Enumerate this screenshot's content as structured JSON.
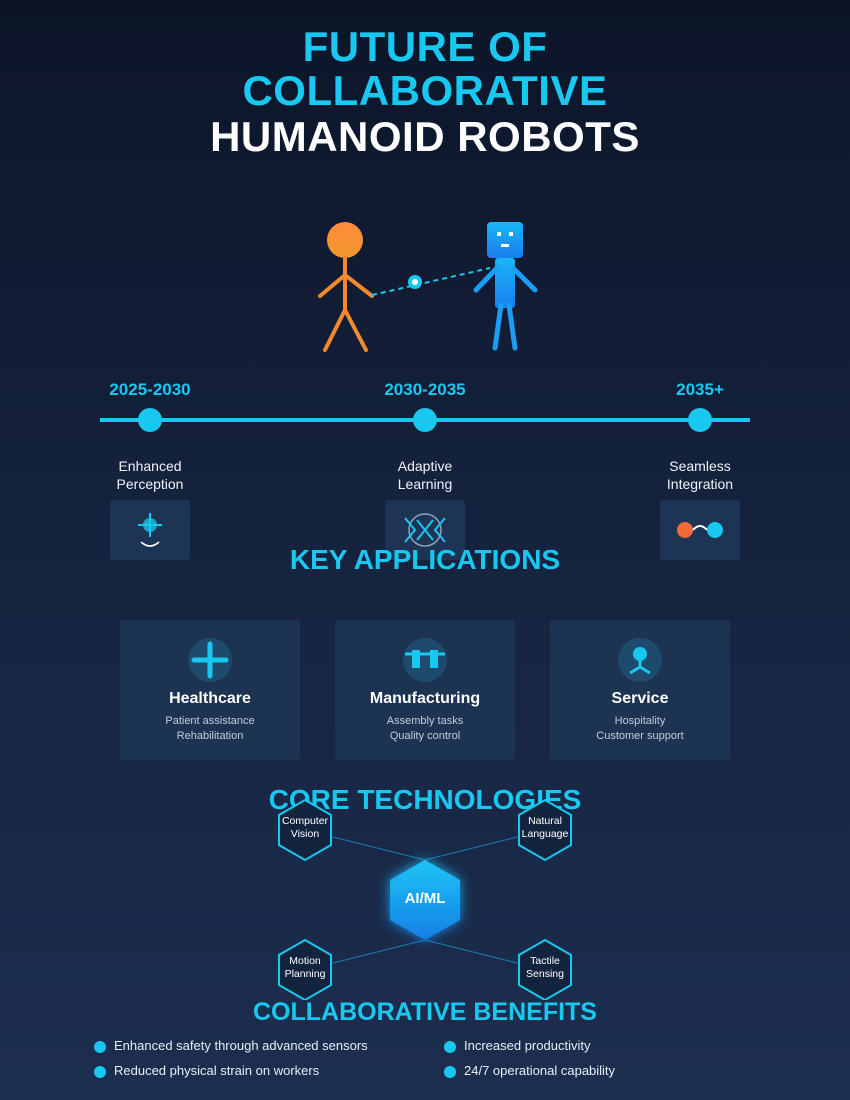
{
  "title": {
    "line1": "FUTURE OF",
    "line2": "COLLABORATIVE",
    "line3": "HUMANOID ROBOTS"
  },
  "colors": {
    "accent": "#19c8f0",
    "human": "#f5892e",
    "robot": "#1a9ef5",
    "background": "#101b33",
    "card": "#1c3352"
  },
  "timeline": [
    {
      "period": "2025-2030",
      "label_line1": "Enhanced",
      "label_line2": "Perception",
      "icon": "crosshair-icon"
    },
    {
      "period": "2030-2035",
      "label_line1": "Adaptive",
      "label_line2": "Learning",
      "icon": "learning-icon"
    },
    {
      "period": "2035+",
      "label_line1": "Seamless",
      "label_line2": "Integration",
      "icon": "connection-icon"
    }
  ],
  "applications": {
    "title": "KEY APPLICATIONS",
    "cards": [
      {
        "title": "Healthcare",
        "line1": "Patient assistance",
        "line2": "Rehabilitation",
        "icon": "medical-cross-icon"
      },
      {
        "title": "Manufacturing",
        "line1": "Assembly tasks",
        "line2": "Quality control",
        "icon": "assembly-icon"
      },
      {
        "title": "Service",
        "line1": "Hospitality",
        "line2": "Customer support",
        "icon": "person-service-icon"
      }
    ]
  },
  "technologies": {
    "title": "CORE TECHNOLOGIES",
    "center": "AI/ML",
    "nodes": [
      {
        "line1": "Computer",
        "line2": "Vision"
      },
      {
        "line1": "Natural",
        "line2": "Language"
      },
      {
        "line1": "Motion",
        "line2": "Planning"
      },
      {
        "line1": "Tactile",
        "line2": "Sensing"
      }
    ]
  },
  "benefits": {
    "title": "COLLABORATIVE BENEFITS",
    "items": [
      "Enhanced safety through advanced sensors",
      "Increased productivity",
      "Reduced physical strain on workers",
      "24/7 operational capability"
    ]
  }
}
